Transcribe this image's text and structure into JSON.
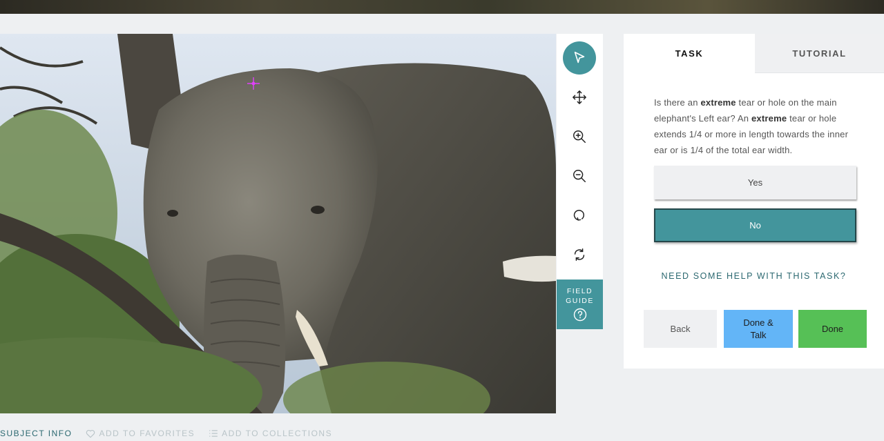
{
  "toolbar": {
    "tools": [
      {
        "name": "annotate-tool",
        "icon": "pointer-arrow-icon",
        "active": true
      },
      {
        "name": "move-tool",
        "icon": "move-arrows-icon",
        "active": false
      },
      {
        "name": "zoom-in-tool",
        "icon": "zoom-in-icon",
        "active": false
      },
      {
        "name": "zoom-out-tool",
        "icon": "zoom-out-icon",
        "active": false
      },
      {
        "name": "rotate-tool",
        "icon": "rotate-icon",
        "active": false
      },
      {
        "name": "reset-tool",
        "icon": "reset-icon",
        "active": false
      }
    ],
    "field_guide_line1": "FIELD",
    "field_guide_line2": "GUIDE",
    "accent_color": "#43959c"
  },
  "tabs": {
    "task": "TASK",
    "tutorial": "TUTORIAL"
  },
  "question": {
    "p1": "Is there an ",
    "b1": "extreme",
    "p2": " tear or hole on the main elephant's Left ear? An ",
    "b2": "extreme",
    "p3": " tear or hole extends 1/4 or more in length towards the inner ear or is 1/4 of the total ear width."
  },
  "answers": {
    "yes": "Yes",
    "no": "No",
    "selected": "No"
  },
  "help_link": "NEED SOME HELP WITH THIS TASK?",
  "actions": {
    "back": "Back",
    "done_talk_line1": "Done &",
    "done_talk_line2": "Talk",
    "done": "Done"
  },
  "meta": {
    "subject_info": "SUBJECT INFO",
    "favorites": "ADD TO FAVORITES",
    "collections": "ADD TO COLLECTIONS"
  },
  "colors": {
    "teal": "#43959c",
    "done_talk_blue": "#63b5f7",
    "done_green": "#56c056",
    "crosshair": "#e040fb"
  }
}
